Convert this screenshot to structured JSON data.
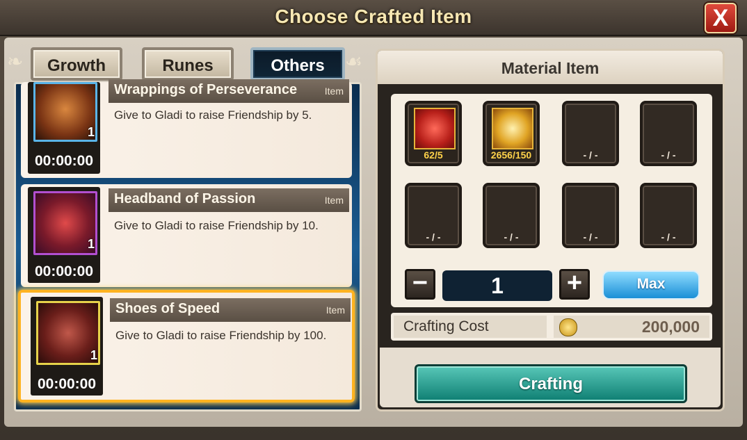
{
  "title": "Choose Crafted Item",
  "close_label": "X",
  "tabs": [
    {
      "label": "Growth",
      "active": false
    },
    {
      "label": "Runes",
      "active": false
    },
    {
      "label": "Others",
      "active": true
    }
  ],
  "items": [
    {
      "name": "Wrappings of Perseverance",
      "tag": "Item",
      "desc": "Give to Gladi to raise Friendship by 5.",
      "qty": "1",
      "timer": "00:00:00",
      "frame_color": "#5ab4e8",
      "selected": false
    },
    {
      "name": "Headband of Passion",
      "tag": "Item",
      "desc": "Give to Gladi to raise Friendship by 10.",
      "qty": "1",
      "timer": "00:00:00",
      "frame_color": "#b24fd0",
      "selected": false
    },
    {
      "name": "Shoes of Speed",
      "tag": "Item",
      "desc": "Give to Gladi to raise Friendship by 100.",
      "qty": "1",
      "timer": "00:00:00",
      "frame_color": "#e6d24a",
      "selected": true
    }
  ],
  "material_panel": {
    "title": "Material Item",
    "slots": [
      {
        "count": "62/5",
        "icon": "red-cloth-icon"
      },
      {
        "count": "2656/150",
        "icon": "gold-pile-icon"
      },
      {
        "count": "- / -"
      },
      {
        "count": "- / -"
      },
      {
        "count": "- / -"
      },
      {
        "count": "- / -"
      },
      {
        "count": "- / -"
      },
      {
        "count": "- / -"
      }
    ],
    "quantity": "1",
    "max_label": "Max",
    "cost_label": "Crafting Cost",
    "cost_value": "200,000",
    "craft_label": "Crafting"
  },
  "colors": {
    "accent_select": "#ffb320",
    "craft_button": "#1a9a8c",
    "max_button": "#28a0e8"
  }
}
